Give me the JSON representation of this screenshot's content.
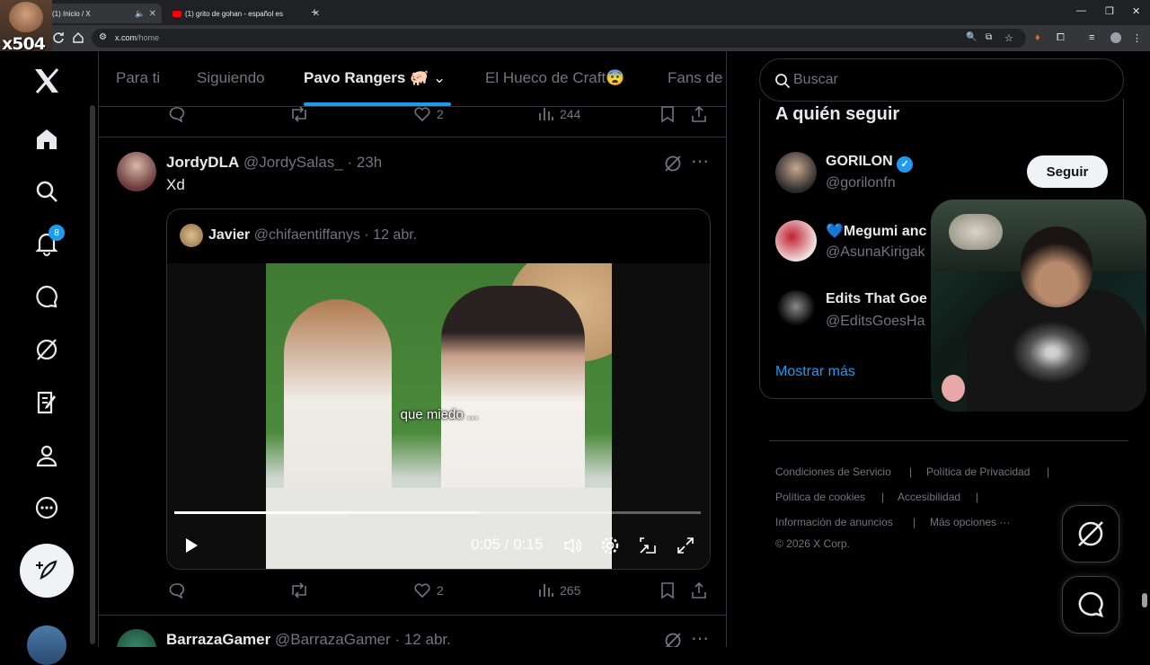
{
  "browser": {
    "tabs": [
      {
        "title": "(1) Inicio / X",
        "active": true
      },
      {
        "title": "(1) grito de gohan - español es",
        "active": false
      }
    ],
    "url_domain": "x.com",
    "url_path": "/home"
  },
  "overlay": {
    "streamer_tag": "x504"
  },
  "nav": {
    "notifications_count": "8",
    "icons": [
      "x-logo-icon",
      "home-icon",
      "search-icon",
      "bell-icon",
      "chat-icon",
      "grok-icon",
      "lists-icon",
      "profile-icon",
      "more-icon",
      "post-icon"
    ]
  },
  "feed": {
    "tabs": [
      "Para ti",
      "Siguiendo",
      "Pavo Rangers 🐖",
      "El Hueco de Craft😨",
      "Fans de"
    ],
    "active_tab": "Pavo Rangers 🐖",
    "prev_post": {
      "likes": "2",
      "views": "244"
    },
    "post": {
      "name": "JordyDLA",
      "handle": "@JordySalas_",
      "time": "· 23h",
      "text": "Xd",
      "quote": {
        "name": "Javier",
        "handle": "@chifaentiffanys",
        "time": "· 12 abr.",
        "caption": "que miedo ...",
        "video_time": "0:05 / 0:15",
        "progress": 0.33
      },
      "likes": "2",
      "views": "265"
    },
    "next_post": {
      "name": "BarrazaGamer",
      "handle": "@BarrazaGamer",
      "time": "· 12 abr."
    }
  },
  "sidebar": {
    "search_placeholder": "Buscar",
    "who_to_follow": {
      "title": "A quién seguir",
      "users": [
        {
          "name": "GORILON",
          "handle": "@gorilonfn",
          "verified": true
        },
        {
          "name": "💙Megumi anc",
          "handle": "@AsunaKirigak"
        },
        {
          "name": "Edits That Goe",
          "handle": "@EditsGoesHa"
        }
      ],
      "follow_label": "Seguir",
      "show_more": "Mostrar más"
    },
    "footer": [
      "Condiciones de Servicio",
      "|",
      "Política de Privacidad",
      "|",
      "Política de cookies",
      "|",
      "Accesibilidad",
      "|",
      "Información de anuncios",
      "|",
      "Más opciones ···",
      "© 2026 X Corp."
    ]
  },
  "colors": {
    "accent": "#1d9bf0",
    "background": "#000000",
    "muted": "#71767b"
  }
}
